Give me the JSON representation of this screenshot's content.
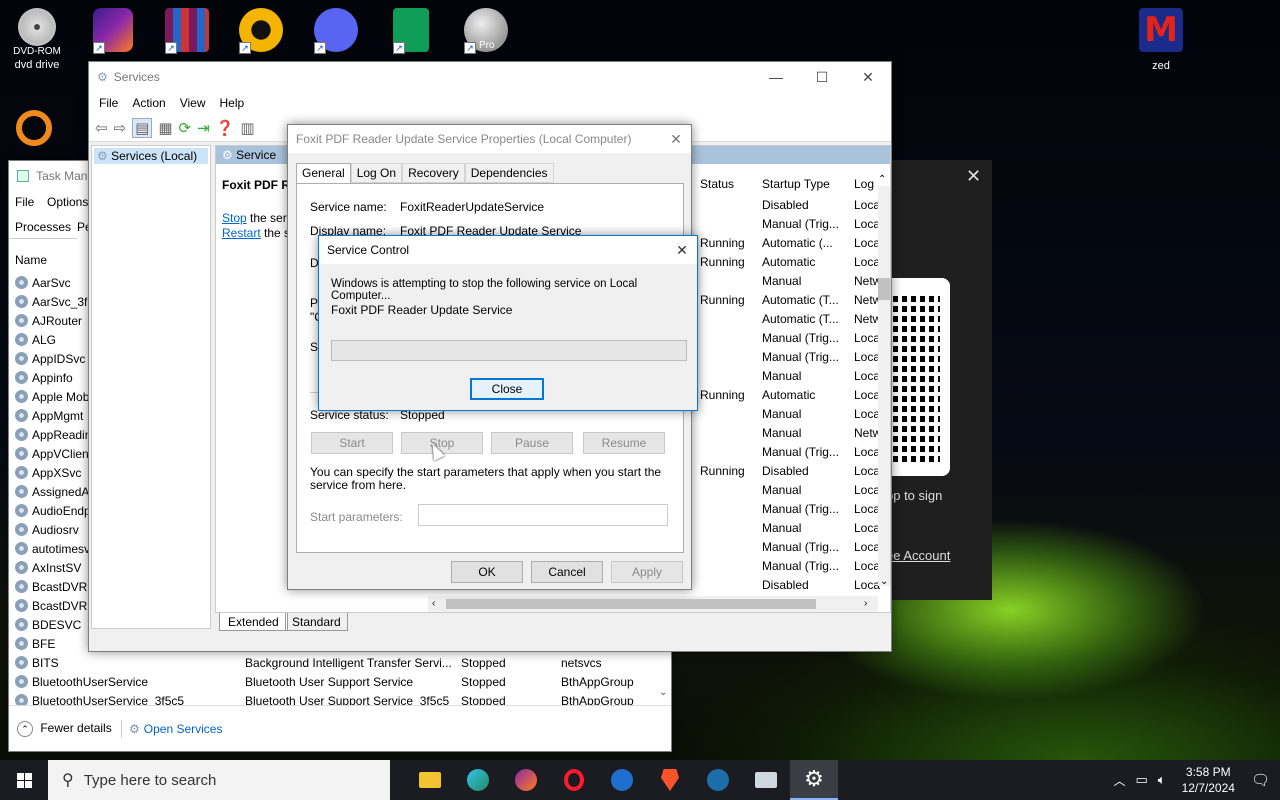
{
  "desktop": {
    "icons": [
      {
        "label": "DVD-ROM",
        "sub": "dvd drive",
        "icon": "dvd-icon"
      },
      {
        "label": "",
        "icon": "firefox-icon"
      },
      {
        "label": "",
        "icon": "winrar-icon"
      },
      {
        "label": "",
        "icon": "aimp-icon"
      },
      {
        "label": "",
        "icon": "discord-icon"
      },
      {
        "label": "",
        "icon": "sheets-icon"
      },
      {
        "label": "Pro",
        "icon": "google-earth-pro-icon"
      },
      {
        "label": "zed",
        "icon": "malwarebytes-icon"
      }
    ],
    "background_widget": {
      "text1": "pp to sign",
      "text2": "ee Account"
    }
  },
  "task_manager": {
    "title": "Task Mana",
    "menu": [
      "File",
      "Options"
    ],
    "tabs": [
      "Processes",
      "Pe"
    ],
    "name_header": "Name",
    "services": [
      "AarSvc",
      "AarSvc_3f5",
      "AJRouter",
      "ALG",
      "AppIDSvc",
      "Appinfo",
      "Apple Mob",
      "AppMgmt",
      "AppReadin",
      "AppVClient",
      "AppXSvc",
      "AssignedA",
      "AudioEndp",
      "Audiosrv",
      "autotimesv",
      "AxInstSV",
      "BcastDVRU",
      "BcastDVRU",
      "BDESVC",
      "BFE",
      "BITS",
      "BluetoothUserService",
      "BluetoothUserService_3f5c5"
    ],
    "bottom_rows": [
      {
        "desc": "Background Intelligent Transfer Servi...",
        "status": "Stopped",
        "group": "netsvcs"
      },
      {
        "desc": "Bluetooth User Support Service",
        "status": "Stopped",
        "group": "BthAppGroup"
      },
      {
        "desc": "Bluetooth User Support Service_3f5c5",
        "status": "Stopped",
        "group": "BthAppGroup"
      }
    ],
    "fewer_details": "Fewer details",
    "open_services": "Open Services"
  },
  "services": {
    "title": "Services",
    "menu": [
      "File",
      "Action",
      "Help"
    ],
    "view_menu": "View",
    "tree_item": "Services (Local)",
    "header_tab": "Service",
    "selected_name": "Foxit PDF Re",
    "stop_link": "Stop",
    "stop_rest": " the serv",
    "restart_link": "Restart",
    "restart_rest": " the se",
    "columns": {
      "status": "Status",
      "startup": "Startup Type",
      "log": "Log"
    },
    "rows": [
      {
        "status": "",
        "startup": "Disabled",
        "log": "Loca"
      },
      {
        "status": "",
        "startup": "Manual (Trig...",
        "log": "Loca"
      },
      {
        "status": "Running",
        "startup": "Automatic (...",
        "log": "Loca"
      },
      {
        "status": "Running",
        "startup": "Automatic",
        "log": "Loca"
      },
      {
        "status": "",
        "startup": "Manual",
        "log": "Netw"
      },
      {
        "status": "Running",
        "startup": "Automatic (T...",
        "log": "Netw"
      },
      {
        "status": "",
        "startup": "Automatic (T...",
        "log": "Netw"
      },
      {
        "status": "",
        "startup": "Manual (Trig...",
        "log": "Loca"
      },
      {
        "status": "",
        "startup": "Manual (Trig...",
        "log": "Loca"
      },
      {
        "status": "",
        "startup": "Manual",
        "log": "Loca"
      },
      {
        "status": "Running",
        "startup": "Automatic",
        "log": "Loca"
      },
      {
        "status": "",
        "startup": "Manual",
        "log": "Loca"
      },
      {
        "status": "",
        "startup": "Manual",
        "log": "Netw"
      },
      {
        "status": "",
        "startup": "Manual (Trig...",
        "log": "Loca"
      },
      {
        "status": "Running",
        "startup": "Disabled",
        "log": "Loca"
      },
      {
        "status": "",
        "startup": "Manual",
        "log": "Loca"
      },
      {
        "status": "",
        "startup": "Manual (Trig...",
        "log": "Loca"
      },
      {
        "status": "",
        "startup": "Manual",
        "log": "Loca"
      },
      {
        "status": "",
        "startup": "Manual (Trig...",
        "log": "Loca"
      },
      {
        "status": "",
        "startup": "Manual (Trig...",
        "log": "Loca"
      },
      {
        "status": "",
        "startup": "Disabled",
        "log": "Loca"
      }
    ],
    "bottom_tabs": [
      "Extended",
      "Standard"
    ]
  },
  "properties": {
    "title": "Foxit PDF Reader Update Service Properties (Local Computer)",
    "tabs": [
      "General",
      "Log On",
      "Recovery",
      "Dependencies"
    ],
    "service_name_label": "Service name:",
    "service_name_value": "FoxitReaderUpdateService",
    "display_name_label": "Display name:",
    "display_name_value": "Foxit PDF Reader Update Service",
    "partial_labels": [
      "De",
      "Pa",
      "\"C",
      "St"
    ],
    "service_status_label": "Service status:",
    "service_status_value": "Stopped",
    "buttons": {
      "start": "Start",
      "stop": "Stop",
      "pause": "Pause",
      "resume": "Resume"
    },
    "hint": "You can specify the start parameters that apply when you start the service from here.",
    "start_params_label": "Start parameters:",
    "start_params_value": "",
    "ok": "OK",
    "cancel": "Cancel",
    "apply": "Apply"
  },
  "service_control": {
    "title": "Service Control",
    "message": "Windows is attempting to stop the following service on Local Computer...",
    "service": "Foxit PDF Reader Update Service",
    "progress": 0,
    "close": "Close"
  },
  "taskbar": {
    "search_placeholder": "Type here to search",
    "time": "3:58 PM",
    "date": "12/7/2024",
    "apps": [
      "file-explorer-icon",
      "edge-icon",
      "firefox-icon",
      "opera-icon",
      "thunderbird-icon",
      "brave-icon",
      "steam-icon",
      "remote-desktop-icon",
      "services-gear-icon"
    ]
  },
  "colors": {
    "accent": "#0078d7",
    "link": "#0066cc",
    "taskbar": "#1a1c22"
  }
}
